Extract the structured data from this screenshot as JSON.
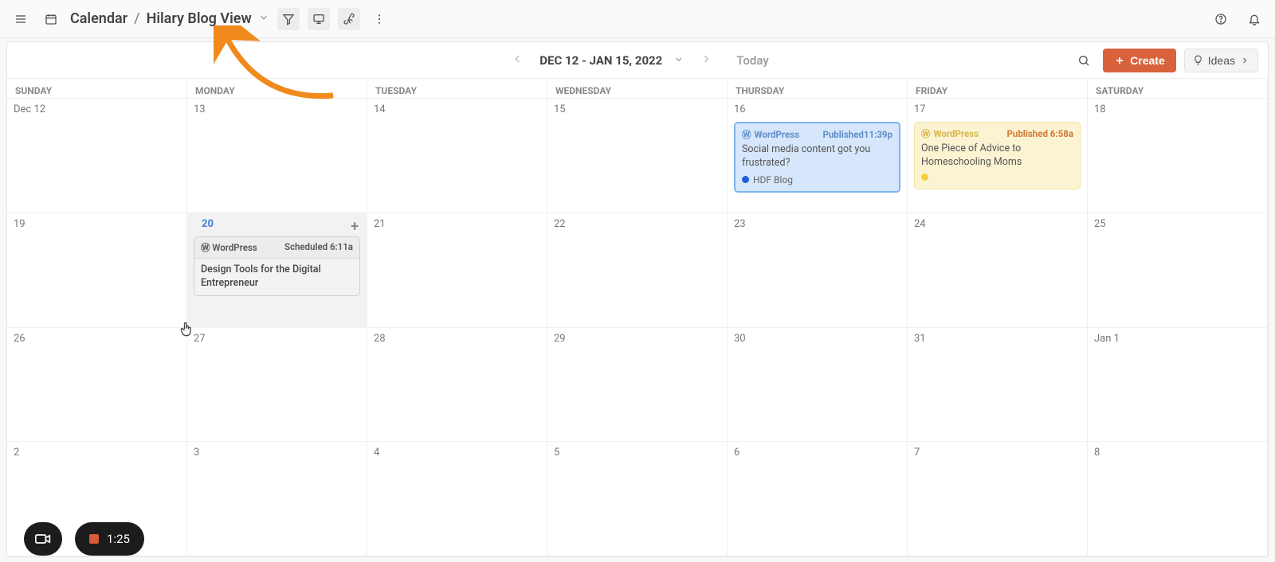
{
  "topbar": {
    "title": "Calendar",
    "view": "Hilary Blog View"
  },
  "toolbar": {
    "range": "DEC 12 - JAN 15, 2022",
    "today": "Today",
    "create": "Create",
    "ideas": "Ideas"
  },
  "days": [
    "SUNDAY",
    "MONDAY",
    "TUESDAY",
    "WEDNESDAY",
    "THURSDAY",
    "FRIDAY",
    "SATURDAY"
  ],
  "weeks": [
    [
      "Dec 12",
      "13",
      "14",
      "15",
      "16",
      "17",
      "18"
    ],
    [
      "19",
      "20",
      "21",
      "22",
      "23",
      "24",
      "25"
    ],
    [
      "26",
      "27",
      "28",
      "29",
      "30",
      "31",
      "Jan 1"
    ],
    [
      "2",
      "3",
      "4",
      "5",
      "6",
      "7",
      "8"
    ]
  ],
  "events": {
    "w0c4": {
      "source": "WordPress",
      "status": "Published",
      "time": "11:39p",
      "title": "Social media content got you frustrated?",
      "tag": "HDF Blog",
      "dot": "#1f5fd4"
    },
    "w0c5": {
      "source": "WordPress",
      "status": "Published",
      "time": "6:58a",
      "title": "One Piece of Advice to Homeschooling Moms",
      "dot": "#f3cf3a"
    },
    "w1c1": {
      "source": "WordPress",
      "status": "Scheduled",
      "time": "6:11a",
      "title": "Design Tools for the Digital Entrepreneur"
    }
  },
  "recorder": {
    "time": "1:25"
  },
  "colors": {
    "accent": "#d8623c"
  }
}
